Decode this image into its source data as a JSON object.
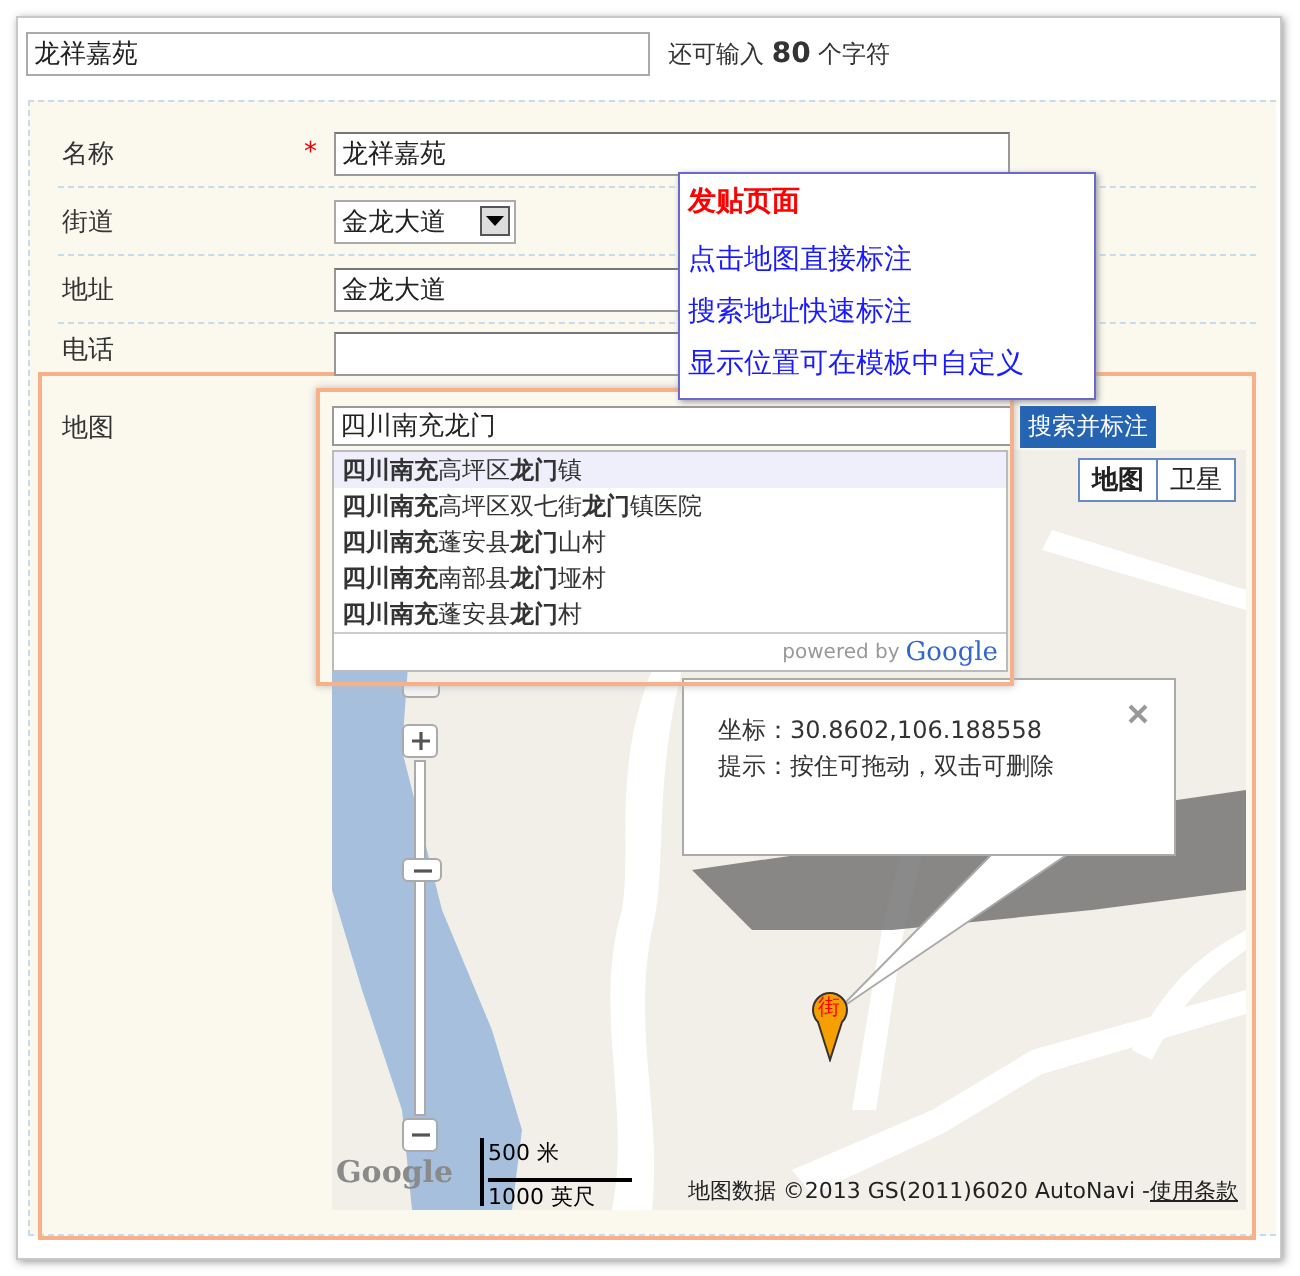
{
  "title_field": {
    "value": "龙祥嘉苑"
  },
  "char_counter": "还可输入 **80** 个字符",
  "form": {
    "rows": [
      {
        "label": "名称",
        "kind": "text",
        "required_mark": "*",
        "value": "龙祥嘉苑"
      },
      {
        "label": "街道",
        "kind": "select",
        "value": "金龙大道"
      },
      {
        "label": "地址",
        "kind": "text",
        "value": "金龙大道"
      },
      {
        "label": "电话",
        "kind": "text"
      }
    ]
  },
  "map_section": {
    "label": "地图",
    "search": {
      "value": "四川南充龙门",
      "button": "搜索并标注",
      "suggestions": [
        {
          "text": "**四川南充**高坪区**龙门**镇",
          "selected": true
        },
        {
          "text": "**四川南充**高坪区双七街**龙门**镇医院",
          "selected": false
        },
        {
          "text": "**四川南充**蓬安县**龙门**山村",
          "selected": false
        },
        {
          "text": "**四川南充**南部县**龙门**垭村",
          "selected": false
        },
        {
          "text": "**四川南充**蓬安县**龙门**村",
          "selected": false
        }
      ],
      "powered_by": "powered by",
      "brand": "Google"
    },
    "map_types": [
      {
        "label": "地图",
        "selected": true
      },
      {
        "label": "卫星",
        "selected": false
      }
    ],
    "zoom": {
      "level": 0.71
    },
    "info_window": {
      "lines": [
        {
          "label": "坐标：",
          "value": "30.8602,106.188558"
        },
        {
          "label": "提示：",
          "value": "按住可拖动，双击可删除"
        }
      ]
    },
    "marker_label": "街",
    "logo": "Google",
    "scale": [
      "500 米",
      "1000 英尺"
    ],
    "attribution": "地图数据 ©2013 GS(2011)6020 AutoNavi - ",
    "terms_link": "使用条款"
  },
  "help_popup": {
    "title": "发贴页面",
    "links": [
      "点击地图直接标注",
      "搜索地址快速标注",
      "显示位置可在模板中自定义"
    ]
  }
}
